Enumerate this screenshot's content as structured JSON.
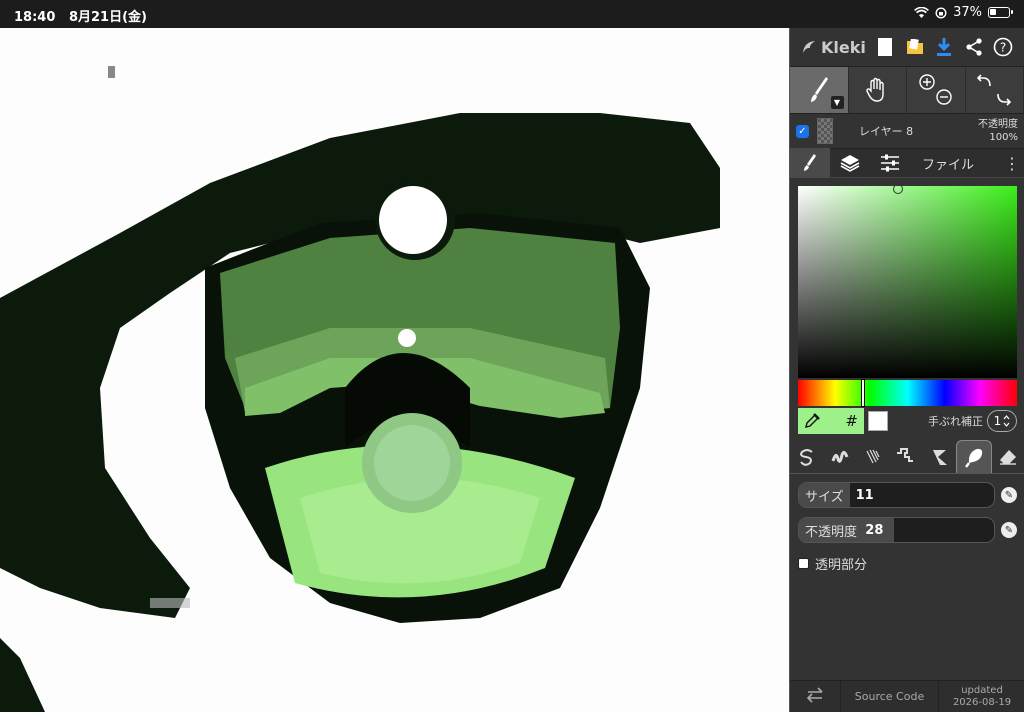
{
  "status": {
    "time": "18:40",
    "date": "8月21日(金)",
    "battery": "37%",
    "battery_level": 0.37
  },
  "app": {
    "name": "Kleki"
  },
  "layer": {
    "name": "レイヤー 8",
    "opacity_label": "不透明度",
    "opacity_value": "100%"
  },
  "tabs": {
    "file": "ファイル"
  },
  "color": {
    "primary": "#9ef08b",
    "secondary": "#ffffff",
    "hex_symbol": "#",
    "stabilizer_label": "手ぶれ補正",
    "stabilizer_value": "1"
  },
  "brush": {
    "size_label": "サイズ",
    "size_value": "11",
    "opacity_label": "不透明度",
    "opacity_value": "28",
    "transparent_label": "透明部分"
  },
  "footer": {
    "source": "Source Code",
    "updated_label": "updated",
    "updated_date": "2026-08-19"
  }
}
